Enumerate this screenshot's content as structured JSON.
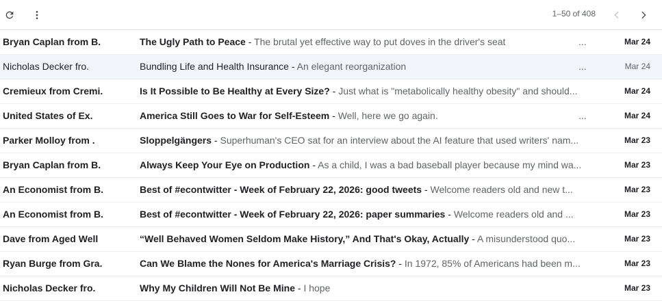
{
  "toolbar": {
    "refresh_icon": "refresh-icon",
    "more_icon": "more-vert-icon",
    "count": "1–50 of 408",
    "prev_icon": "chevron-left-icon",
    "next_icon": "chevron-right-icon"
  },
  "emails": [
    {
      "sender": "Bryan Caplan from B.",
      "subject": "The Ugly Path to Peace",
      "snippet": "The brutal yet effective way to put doves in the driver's seat",
      "trail": "...",
      "date": "Mar 24",
      "unread": true
    },
    {
      "sender": "Nicholas Decker fro.",
      "subject": "Bundling Life and Health Insurance",
      "snippet": "An elegant reorganization",
      "trail": "...",
      "date": "Mar 24",
      "unread": false
    },
    {
      "sender": "Cremieux from Cremi.",
      "subject": "Is It Possible to Be Healthy at Every Size?",
      "snippet": "Just what is \"metabolically healthy obesity\" and should...",
      "trail": "",
      "date": "Mar 24",
      "unread": true
    },
    {
      "sender": "United States of Ex.",
      "subject": "America Still Goes to War for Self-Esteem",
      "snippet": "Well, here we go again.",
      "trail": "...",
      "date": "Mar 24",
      "unread": true
    },
    {
      "sender": "Parker Molloy from .",
      "subject": "Sloppelgängers",
      "snippet": "Superhuman's CEO sat for an interview about the AI feature that used writers' nam...",
      "trail": "",
      "date": "Mar 23",
      "unread": true
    },
    {
      "sender": "Bryan Caplan from B.",
      "subject": "Always Keep Your Eye on Production",
      "snippet": "As a child, I was a bad baseball player because my mind wa...",
      "trail": "",
      "date": "Mar 23",
      "unread": true
    },
    {
      "sender": "An Economist from B.",
      "subject": "Best of #econtwitter - Week of February 22, 2026: good tweets",
      "snippet": "Welcome readers old and new t...",
      "trail": "",
      "date": "Mar 23",
      "unread": true
    },
    {
      "sender": "An Economist from B.",
      "subject": "Best of #econtwitter - Week of February 22, 2026: paper summaries",
      "snippet": "Welcome readers old and ...",
      "trail": "",
      "date": "Mar 23",
      "unread": true
    },
    {
      "sender": "Dave from Aged Well",
      "subject": "“Well Behaved Women Seldom Make History,” And That's Okay, Actually",
      "snippet": "A misunderstood quo...",
      "trail": "",
      "date": "Mar 23",
      "unread": true
    },
    {
      "sender": "Ryan Burge from Gra.",
      "subject": "Can We Blame the Nones for America's Marriage Crisis?",
      "snippet": "In 1972, 85% of Americans had been m...",
      "trail": "",
      "date": "Mar 23",
      "unread": true
    },
    {
      "sender": "Nicholas Decker fro.",
      "subject": "Why My Children Will Not Be Mine",
      "snippet": "I hope",
      "trail": "",
      "date": "Mar 23",
      "unread": true
    }
  ]
}
